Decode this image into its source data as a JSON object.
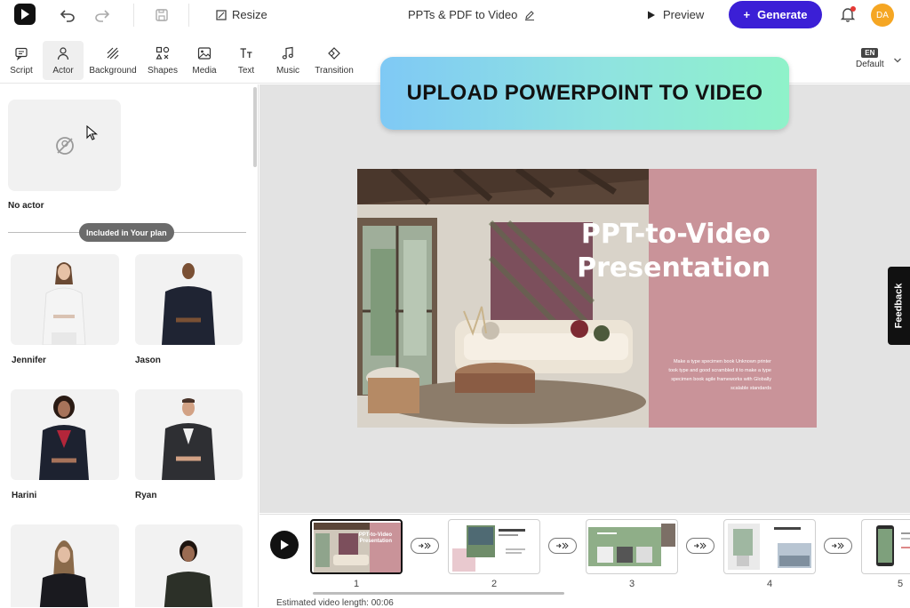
{
  "topbar": {
    "resize_label": "Resize",
    "doc_title": "PPTs & PDF to Video",
    "preview_label": "Preview",
    "generate_label": "Generate",
    "avatar_initials": "DA",
    "accent_color": "#3b1fd6"
  },
  "toolbar": {
    "tools": [
      "Script",
      "Actor",
      "Background",
      "Shapes",
      "Media",
      "Text",
      "Music",
      "Transition"
    ],
    "active_tool": "Actor",
    "language_code": "EN",
    "language_label": "Default"
  },
  "sidebar": {
    "no_actor_label": "No actor",
    "plan_pill": "Included in Your plan",
    "actors": [
      "Jennifer",
      "Jason",
      "Harini",
      "Ryan"
    ]
  },
  "banner": {
    "text": "UPLOAD POWERPOINT TO VIDEO"
  },
  "slide": {
    "title_line1": "PPT-to-Video",
    "title_line2": "Presentation",
    "body_text": "Make a type specimen book Unknown printer took type and good scrambled it to make a type specimen book agile frameworks with Globally scalable standards",
    "panel_color": "#c99399"
  },
  "feedback_label": "Feedback",
  "timeline": {
    "thumb1_title": "PPT-to-Video Presentation",
    "slide_numbers": [
      "1",
      "2",
      "3",
      "4",
      "5"
    ],
    "estimate_label": "Estimated video length: 00:06"
  }
}
